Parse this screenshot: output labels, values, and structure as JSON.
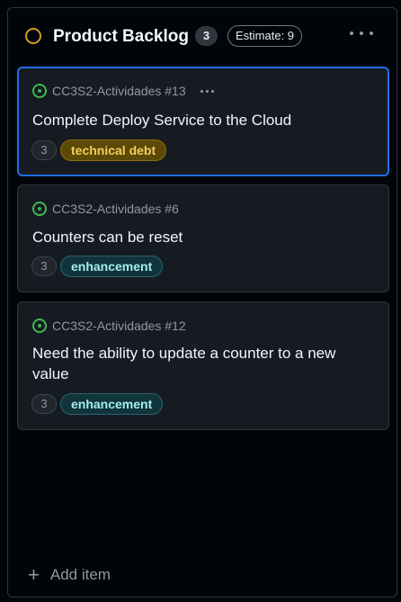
{
  "column": {
    "title": "Product Backlog",
    "count": "3",
    "estimate": "Estimate: 9",
    "status_color": "#d29922"
  },
  "cards": [
    {
      "repo": "CC3S2-Actividades #13",
      "title": "Complete Deploy Service to the Cloud",
      "number": "3",
      "label": "technical debt",
      "state_icon": "issue-open-icon"
    },
    {
      "repo": "CC3S2-Actividades #6",
      "title": "Counters can be reset",
      "number": "3",
      "label": "enhancement",
      "state_icon": "issue-open-icon"
    },
    {
      "repo": "CC3S2-Actividades #12",
      "title": "Need the ability to update a counter to a new value",
      "number": "3",
      "label": "enhancement",
      "state_icon": "issue-open-icon"
    }
  ],
  "add_item": {
    "label": "Add item",
    "icon": "plus-icon"
  },
  "colors": {
    "accent_selected": "#1f6feb",
    "open_issue": "#3fb950",
    "label_debt": "#f2cc60",
    "label_enhancement": "#a2eeef"
  }
}
